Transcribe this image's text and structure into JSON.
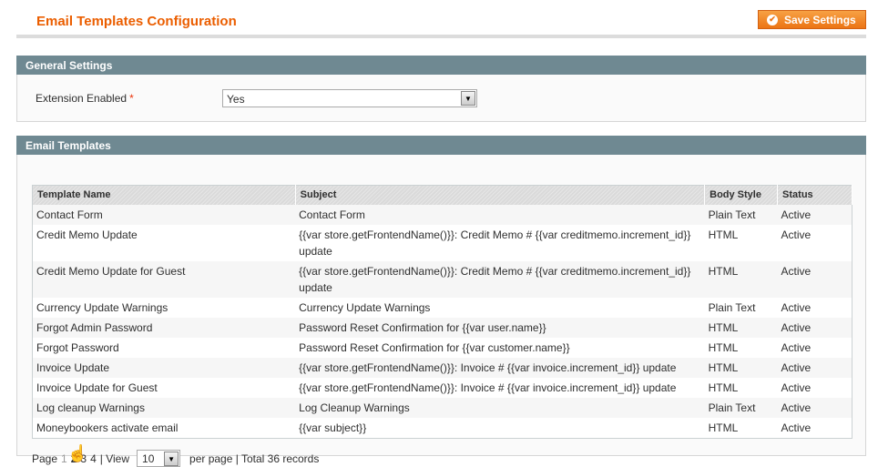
{
  "header": {
    "title": "Email Templates Configuration",
    "save_label": "Save Settings"
  },
  "general": {
    "title": "General Settings",
    "field_label": "Extension Enabled",
    "required_mark": "*",
    "value": "Yes"
  },
  "templates": {
    "title": "Email Templates",
    "columns": [
      "Template Name",
      "Subject",
      "Body Style",
      "Status"
    ],
    "rows": [
      [
        "Contact Form",
        "Contact Form",
        "Plain Text",
        "Active"
      ],
      [
        "Credit Memo Update",
        "{{var store.getFrontendName()}}: Credit Memo # {{var creditmemo.increment_id}} update",
        "HTML",
        "Active"
      ],
      [
        "Credit Memo Update for Guest",
        "{{var store.getFrontendName()}}: Credit Memo # {{var creditmemo.increment_id}} update",
        "HTML",
        "Active"
      ],
      [
        "Currency Update Warnings",
        "Currency Update Warnings",
        "Plain Text",
        "Active"
      ],
      [
        "Forgot Admin Password",
        "Password Reset Confirmation for {{var user.name}}",
        "HTML",
        "Active"
      ],
      [
        "Forgot Password",
        "Password Reset Confirmation for {{var customer.name}}",
        "HTML",
        "Active"
      ],
      [
        "Invoice Update",
        "{{var store.getFrontendName()}}: Invoice # {{var invoice.increment_id}} update",
        "HTML",
        "Active"
      ],
      [
        "Invoice Update for Guest",
        "{{var store.getFrontendName()}}: Invoice # {{var invoice.increment_id}} update",
        "HTML",
        "Active"
      ],
      [
        "Log cleanup Warnings",
        "Log Cleanup Warnings",
        "Plain Text",
        "Active"
      ],
      [
        "Moneybookers activate email",
        "{{var subject}}",
        "HTML",
        "Active"
      ]
    ]
  },
  "pager": {
    "page_label": "Page",
    "pages": [
      "1",
      "2",
      "3",
      "4"
    ],
    "current": "1",
    "view_label": "| View",
    "per_page": "10",
    "per_page_label": "per page | Total 36 records"
  },
  "colors": {
    "accent": "#eb5e00",
    "section_header": "#6f8992"
  }
}
